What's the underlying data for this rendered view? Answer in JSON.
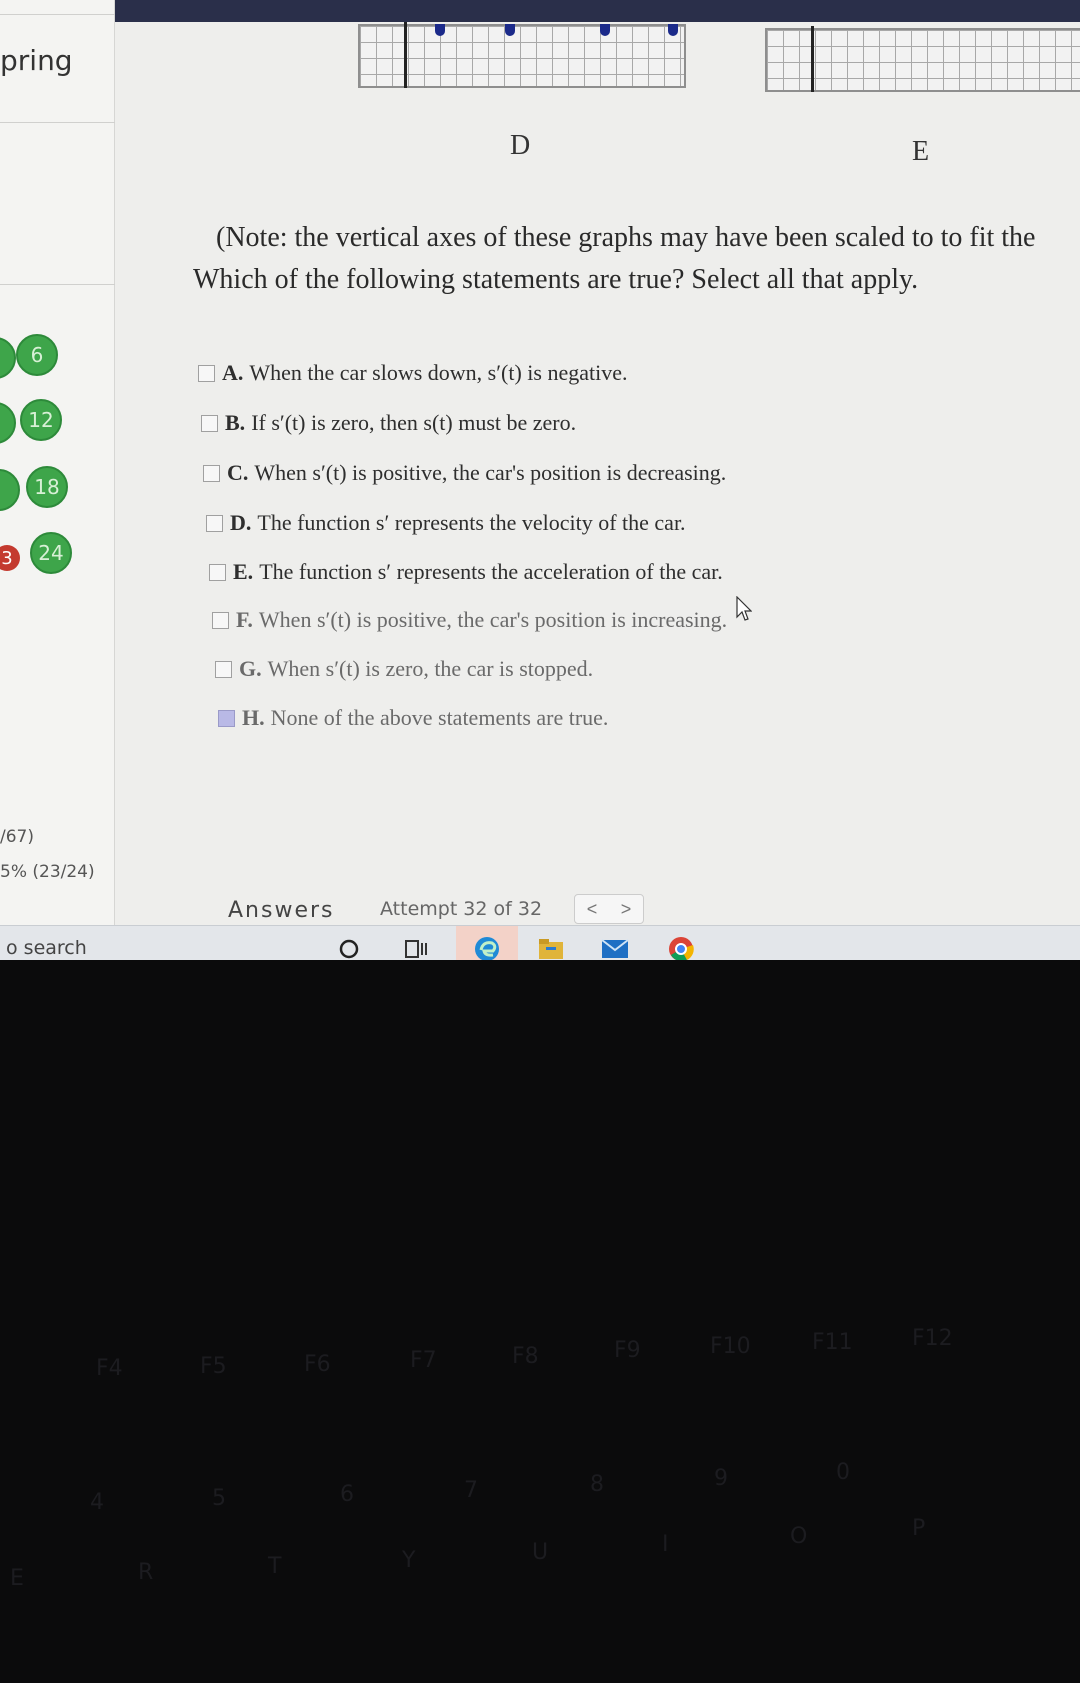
{
  "sidebar": {
    "course_name": "pring",
    "question_groups": [
      "6",
      "12",
      "18",
      "24"
    ],
    "red_badge": "3",
    "stats": [
      "/67)",
      "5% (23/24)"
    ]
  },
  "graphs": {
    "labels": [
      "D",
      "E"
    ]
  },
  "question": {
    "note": "(Note: the vertical axes of these graphs may have been scaled to to fit the",
    "prompt": "Which of the following statements are true? Select all that apply.",
    "options": [
      {
        "letter": "A.",
        "text": "When the car slows down, s′(t) is negative.",
        "checked": false
      },
      {
        "letter": "B.",
        "text": "If s′(t) is zero, then s(t) must be zero.",
        "checked": false
      },
      {
        "letter": "C.",
        "text": "When s′(t) is positive, the car's position is decreasing.",
        "checked": false
      },
      {
        "letter": "D.",
        "text": "The function s′ represents the velocity of the car.",
        "checked": false
      },
      {
        "letter": "E.",
        "text": "The function s′ represents the acceleration of the car.",
        "checked": false
      },
      {
        "letter": "F.",
        "text": "When s′(t) is positive, the car's position is increasing.",
        "checked": false
      },
      {
        "letter": "G.",
        "text": "When s′(t) is zero, the car is stopped.",
        "checked": false
      },
      {
        "letter": "H.",
        "text": "None of the above statements are true.",
        "checked": true
      }
    ]
  },
  "answers_bar": {
    "label": "Answers",
    "attempt": "Attempt 32 of 32",
    "prev": "<",
    "next": ">"
  },
  "taskbar": {
    "search": "o search",
    "icons": [
      "cortana-circle-icon",
      "task-view-icon",
      "edge-icon",
      "file-explorer-icon",
      "mail-icon",
      "chrome-icon"
    ]
  },
  "keyboard": {
    "function_row": [
      "F4",
      "F5",
      "F6",
      "F7",
      "F8",
      "F9",
      "F10",
      "F11",
      "F12"
    ],
    "number_row": [
      "4",
      "5",
      "6",
      "7",
      "8",
      "9",
      "0"
    ],
    "letter_row": [
      "E",
      "R",
      "T",
      "Y",
      "U",
      "I",
      "O",
      "P"
    ]
  },
  "colors": {
    "badge_green": "#3ea54a",
    "badge_red": "#c43a2f",
    "checkbox_selected": "#b9b9e6"
  }
}
